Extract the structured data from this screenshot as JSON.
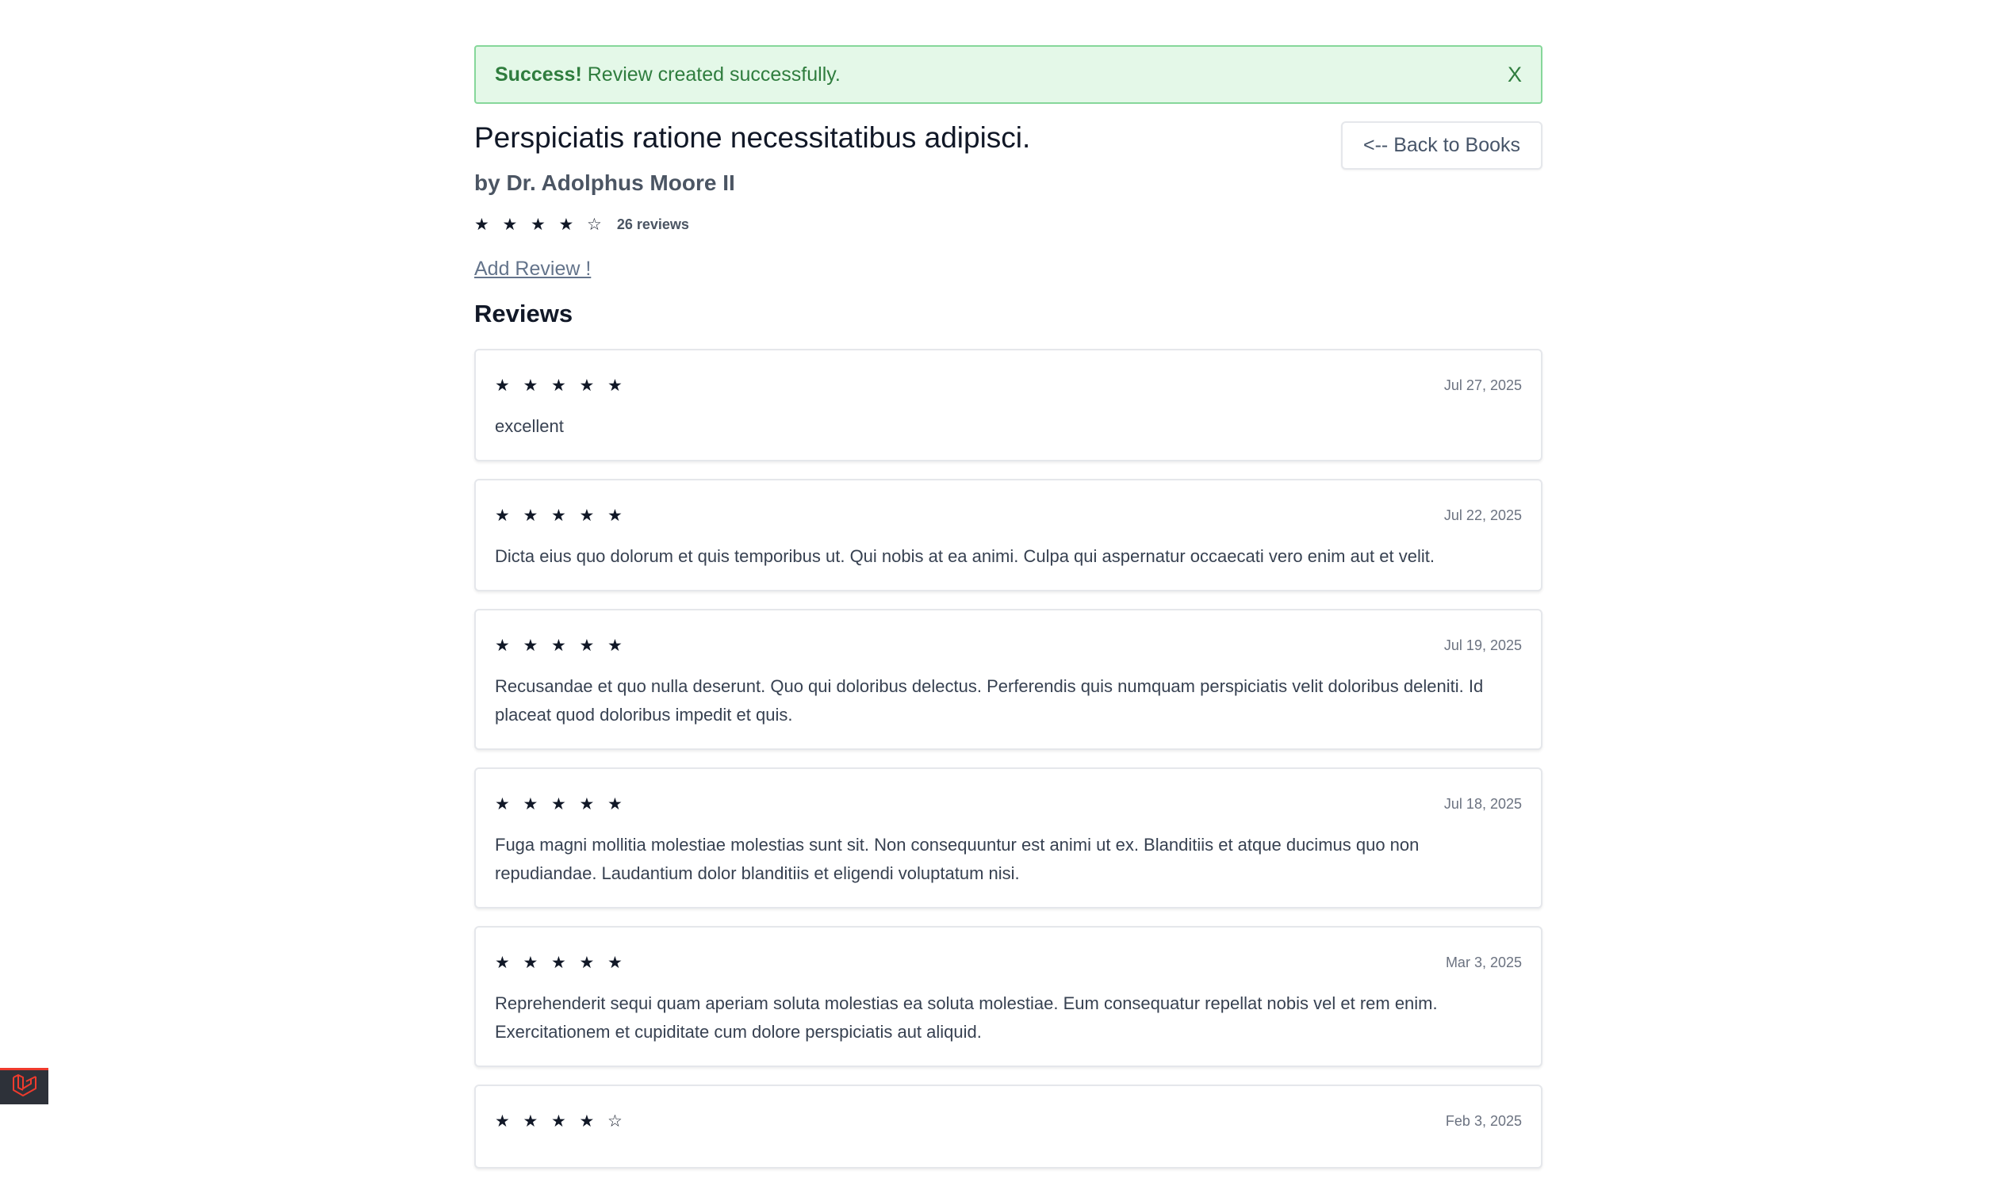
{
  "alert": {
    "title": "Success!",
    "message": "Review created successfully.",
    "close_label": "X",
    "bg": "#e4f8e8",
    "border": "#86d79a",
    "text": "#2f7d3e"
  },
  "book": {
    "title": "Perspiciatis ratione necessitatibus adipisci.",
    "author": "by Dr. Adolphus Moore II",
    "rating": 4,
    "stars": "★ ★ ★ ★ ☆",
    "review_count": "26 reviews"
  },
  "actions": {
    "back_label": "<-- Back to Books",
    "add_review_label": "Add Review !"
  },
  "reviews_heading": "Reviews",
  "reviews": [
    {
      "stars": "★ ★ ★ ★ ★",
      "rating": 5,
      "date": "Jul 27, 2025",
      "text": "excellent"
    },
    {
      "stars": "★ ★ ★ ★ ★",
      "rating": 5,
      "date": "Jul 22, 2025",
      "text": "Dicta eius quo dolorum et quis temporibus ut. Qui nobis at ea animi. Culpa qui aspernatur occaecati vero enim aut et velit."
    },
    {
      "stars": "★ ★ ★ ★ ★",
      "rating": 5,
      "date": "Jul 19, 2025",
      "text": "Recusandae et quo nulla deserunt. Quo qui doloribus delectus. Perferendis quis numquam perspiciatis velit doloribus deleniti. Id placeat quod doloribus impedit et quis."
    },
    {
      "stars": "★ ★ ★ ★ ★",
      "rating": 5,
      "date": "Jul 18, 2025",
      "text": "Fuga magni mollitia molestiae molestias sunt sit. Non consequuntur est animi ut ex. Blanditiis et atque ducimus quo non repudiandae. Laudantium dolor blanditiis et eligendi voluptatum nisi."
    },
    {
      "stars": "★ ★ ★ ★ ★",
      "rating": 5,
      "date": "Mar 3, 2025",
      "text": "Reprehenderit sequi quam aperiam soluta molestias ea soluta molestiae. Eum consequatur repellat nobis vel et rem enim. Exercitationem et cupiditate cum dolore perspiciatis aut aliquid."
    },
    {
      "stars": "★ ★ ★ ★ ☆",
      "rating": 4,
      "date": "Feb 3, 2025",
      "text": ""
    }
  ],
  "debug_badge": {
    "icon": "laravel-icon",
    "accent": "#ef3b2d"
  }
}
